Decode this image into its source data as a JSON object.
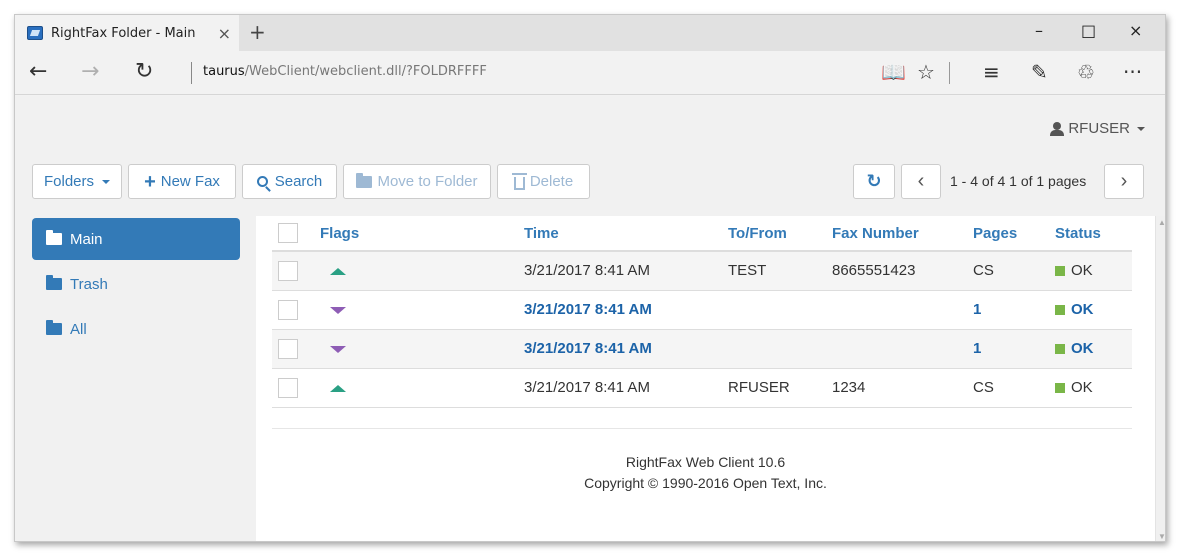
{
  "browser": {
    "tab_title": "RightFax Folder - Main",
    "tab_close": "×",
    "new_tab": "+",
    "url_host": "taurus",
    "url_path": "/WebClient/webclient.dll/?FOLDRFFFF",
    "window_controls": {
      "minimize": "–",
      "maximize": "□",
      "close": "×"
    },
    "nav": {
      "back": "←",
      "forward": "→",
      "refresh": "↻"
    },
    "toolbar": {
      "reading_view": "📖",
      "favorite": "☆",
      "hub": "≡",
      "web_note": "✎",
      "share": "♲",
      "more": "···"
    }
  },
  "app": {
    "user": "RFUSER",
    "toolbar": {
      "folders": "Folders",
      "new_fax": "New Fax",
      "search": "Search",
      "move_to_folder": "Move to Folder",
      "delete": "Delete",
      "refresh_icon": "↻",
      "prev": "‹",
      "next": "›",
      "pager": "1 - 4 of 4 1 of 1 pages"
    },
    "sidebar": [
      {
        "label": "Main",
        "active": true
      },
      {
        "label": "Trash",
        "active": false
      },
      {
        "label": "All",
        "active": false
      }
    ],
    "table": {
      "headers": [
        "Flags",
        "Time",
        "To/From",
        "Fax Number",
        "Pages",
        "Status"
      ],
      "rows": [
        {
          "flag": "up",
          "time": "3/21/2017 8:41 AM",
          "to_from": "TEST",
          "fax_number": "8665551423",
          "pages": "CS",
          "status": "OK",
          "unread": false
        },
        {
          "flag": "down",
          "time": "3/21/2017 8:41 AM",
          "to_from": "",
          "fax_number": "",
          "pages": "1",
          "status": "OK",
          "unread": true
        },
        {
          "flag": "down",
          "time": "3/21/2017 8:41 AM",
          "to_from": "",
          "fax_number": "",
          "pages": "1",
          "status": "OK",
          "unread": true
        },
        {
          "flag": "up",
          "time": "3/21/2017 8:41 AM",
          "to_from": "RFUSER",
          "fax_number": "1234",
          "pages": "CS",
          "status": "OK",
          "unread": false
        }
      ]
    },
    "footer": {
      "line1": "RightFax Web Client 10.6",
      "line2": "Copyright © 1990-2016 Open Text, Inc."
    },
    "colors": {
      "accent": "#337ab7",
      "status_ok": "#7ab648",
      "flag_out": "#2aa084",
      "flag_in": "#8e5db5"
    }
  }
}
